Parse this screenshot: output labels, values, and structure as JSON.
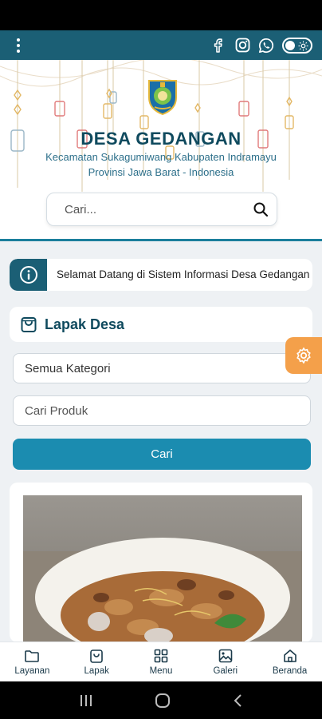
{
  "header": {
    "village_name": "DESA GEDANGAN",
    "subtitle_line1": "Kecamatan Sukagumiwang Kabupaten Indramayu",
    "subtitle_line2": "Provinsi Jawa Barat - Indonesia",
    "search_placeholder": "Cari..."
  },
  "app_bar": {
    "icons": [
      "menu-dots-icon",
      "facebook-icon",
      "instagram-icon",
      "whatsapp-icon",
      "theme-toggle"
    ]
  },
  "marquee": {
    "text": "Selamat Datang di Sistem Informasi Desa Gedangan"
  },
  "lapak": {
    "title": "Lapak Desa",
    "category_selected": "Semua Kategori",
    "product_placeholder": "Cari Produk",
    "search_button": "Cari"
  },
  "bottom_nav": {
    "items": [
      {
        "label": "Layanan",
        "icon": "folder-icon"
      },
      {
        "label": "Lapak",
        "icon": "shopping-bag-icon"
      },
      {
        "label": "Menu",
        "icon": "grid-icon"
      },
      {
        "label": "Galeri",
        "icon": "image-icon"
      },
      {
        "label": "Beranda",
        "icon": "home-icon"
      }
    ]
  },
  "colors": {
    "primary": "#1b5f75",
    "accent_button": "#1b8cb0",
    "settings_fab": "#f4a04a",
    "title_text": "#0f4a5e"
  }
}
